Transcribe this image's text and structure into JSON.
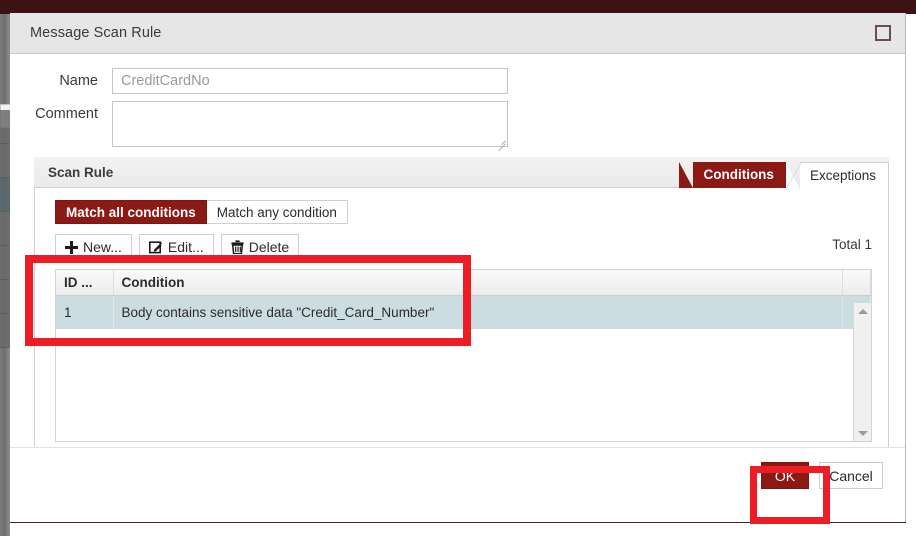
{
  "window": {
    "title": "Message Scan Rule",
    "maximize_icon": "maximize-icon"
  },
  "form": {
    "name_label": "Name",
    "name_value": "CreditCardNo",
    "comment_label": "Comment",
    "comment_value": ""
  },
  "panel": {
    "title": "Scan Rule",
    "tabs": [
      {
        "label": "Conditions",
        "active": true
      },
      {
        "label": "Exceptions",
        "active": false
      }
    ]
  },
  "match": {
    "all_label": "Match all conditions",
    "any_label": "Match any condition",
    "selected": "Match all conditions"
  },
  "toolbar": {
    "new_label": "New...",
    "edit_label": "Edit...",
    "delete_label": "Delete",
    "total_label": "Total 1",
    "new_icon": "plus-icon",
    "edit_icon": "pencil-square-icon",
    "delete_icon": "trash-icon"
  },
  "grid": {
    "columns": [
      "ID ...",
      "Condition"
    ],
    "rows": [
      {
        "id": "1",
        "condition": "Body contains sensitive data \"Credit_Card_Number\"",
        "selected": true
      }
    ],
    "scrollbar": {
      "up_icon": "caret-up-icon",
      "down_icon": "caret-down-icon"
    }
  },
  "footer": {
    "ok_label": "OK",
    "cancel_label": "Cancel"
  },
  "colors": {
    "accent": "#8b1a15",
    "annotation": "#ee1c25",
    "row_selected": "#ccdde2",
    "titlebar": "#e6e6e6"
  }
}
